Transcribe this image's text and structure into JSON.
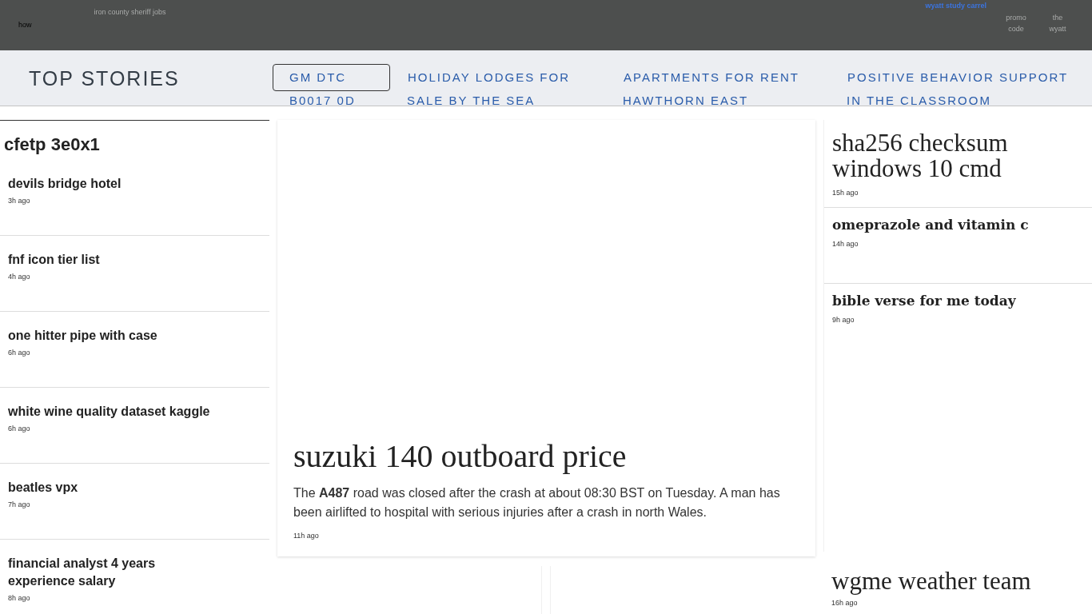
{
  "top_bar": {
    "left": [
      {
        "text": "how",
        "kind": "label"
      },
      {
        "text": "iron county sheriff jobs",
        "kind": "caption"
      }
    ],
    "right": [
      {
        "text": "wyatt study carrel",
        "kind": "link"
      },
      {
        "text": "promo code",
        "kind": "stacked"
      },
      {
        "text": "the wyatt",
        "kind": "stacked"
      }
    ]
  },
  "header": {
    "title": "TOP STORIES",
    "nav": [
      {
        "lines": [
          "GM DTC",
          "B0017 0D"
        ],
        "selected": true
      },
      {
        "lines": [
          "HOLIDAY LODGES FOR",
          "SALE BY THE SEA"
        ],
        "selected": false
      },
      {
        "lines": [
          "APARTMENTS FOR RENT",
          "HAWTHORN EAST"
        ],
        "selected": false
      },
      {
        "lines": [
          "POSITIVE BEHAVIOR SUPPORT",
          "IN THE CLASSROOM"
        ],
        "selected": false
      }
    ]
  },
  "sidebar": {
    "heading": "cfetp 3e0x1",
    "stories": [
      {
        "title": "devils bridge hotel",
        "time": "3h ago"
      },
      {
        "title": "fnf icon tier list",
        "time": "4h ago"
      },
      {
        "title": "one hitter pipe with case",
        "time": "6h ago"
      },
      {
        "title": "white wine quality dataset kaggle",
        "time": "6h ago"
      },
      {
        "title": "beatles vpx",
        "time": "7h ago"
      },
      {
        "title": "financial analyst 4 years experience salary",
        "time": "8h ago"
      }
    ]
  },
  "featured": {
    "headline": "suzuki 140 outboard price",
    "summary": "The **A487** road was closed after the crash at about 08:30 BST on Tuesday. A man has been airlifted to hospital with serious injuries after a crash in north Wales.",
    "time": "11h ago"
  },
  "right_column": {
    "stories": [
      {
        "title": "sha256 checksum windows 10 cmd",
        "time": "15h ago",
        "kind": "large"
      },
      {
        "title": "omeprazole and vitamin c",
        "time": "14h ago",
        "kind": "compact"
      },
      {
        "title": "bible verse for me today",
        "time": "9h ago",
        "kind": "compact"
      }
    ],
    "bottom_story": {
      "title": "wgme weather team",
      "time": "16h ago"
    }
  }
}
